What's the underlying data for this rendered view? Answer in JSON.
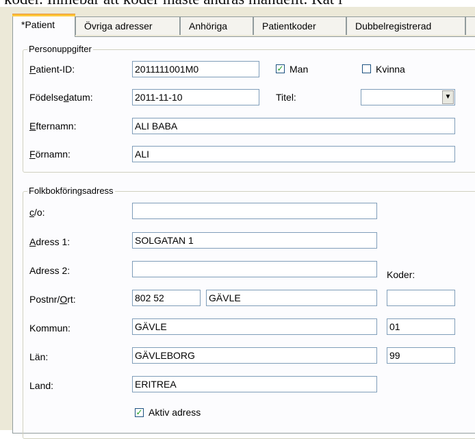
{
  "background_text": "koder. Inmebar att koder måste ändras manuellt. Kat i",
  "tabs": [
    {
      "label": "*Patient",
      "active": true
    },
    {
      "label": "Övriga adresser"
    },
    {
      "label": "Anhöriga"
    },
    {
      "label": "Patientkoder"
    },
    {
      "label": "Dubbelregistrerad"
    }
  ],
  "personal": {
    "legend": "Personuppgifter",
    "patient_id_label": "Patient-ID:",
    "patient_id_value": "2011111001M0",
    "man_label": "Man",
    "man_checked": true,
    "kvinna_label": "Kvinna",
    "kvinna_checked": false,
    "birthdate_label": "Födelsedatum:",
    "birthdate_value": "2011-11-10",
    "title_label": "Titel:",
    "title_value": "",
    "lastname_label": "Efternamn:",
    "lastname_value": "ALI BABA",
    "firstname_label": "Förnamn:",
    "firstname_value": "ALI"
  },
  "address": {
    "legend": "Folkbokföringsadress",
    "co_label": "c/o:",
    "co_value": "",
    "addr1_label": "Adress 1:",
    "addr1_value": "SOLGATAN 1",
    "addr2_label": "Adress 2:",
    "addr2_value": "",
    "codes_label": "Koder:",
    "postal_label": "Postnr/Ort:",
    "postal_value": "802 52",
    "city_value": "GÄVLE",
    "city_code": "",
    "municipality_label": "Kommun:",
    "municipality_value": "GÄVLE",
    "municipality_code": "01",
    "county_label": "Län:",
    "county_value": "GÄVLEBORG",
    "county_code": "99",
    "country_label": "Land:",
    "country_value": "ERITREA",
    "active_label": "Aktiv adress",
    "active_checked": true
  },
  "icons": {
    "checkmark": "checkmark-icon",
    "dropdown": "chevron-down-icon"
  }
}
